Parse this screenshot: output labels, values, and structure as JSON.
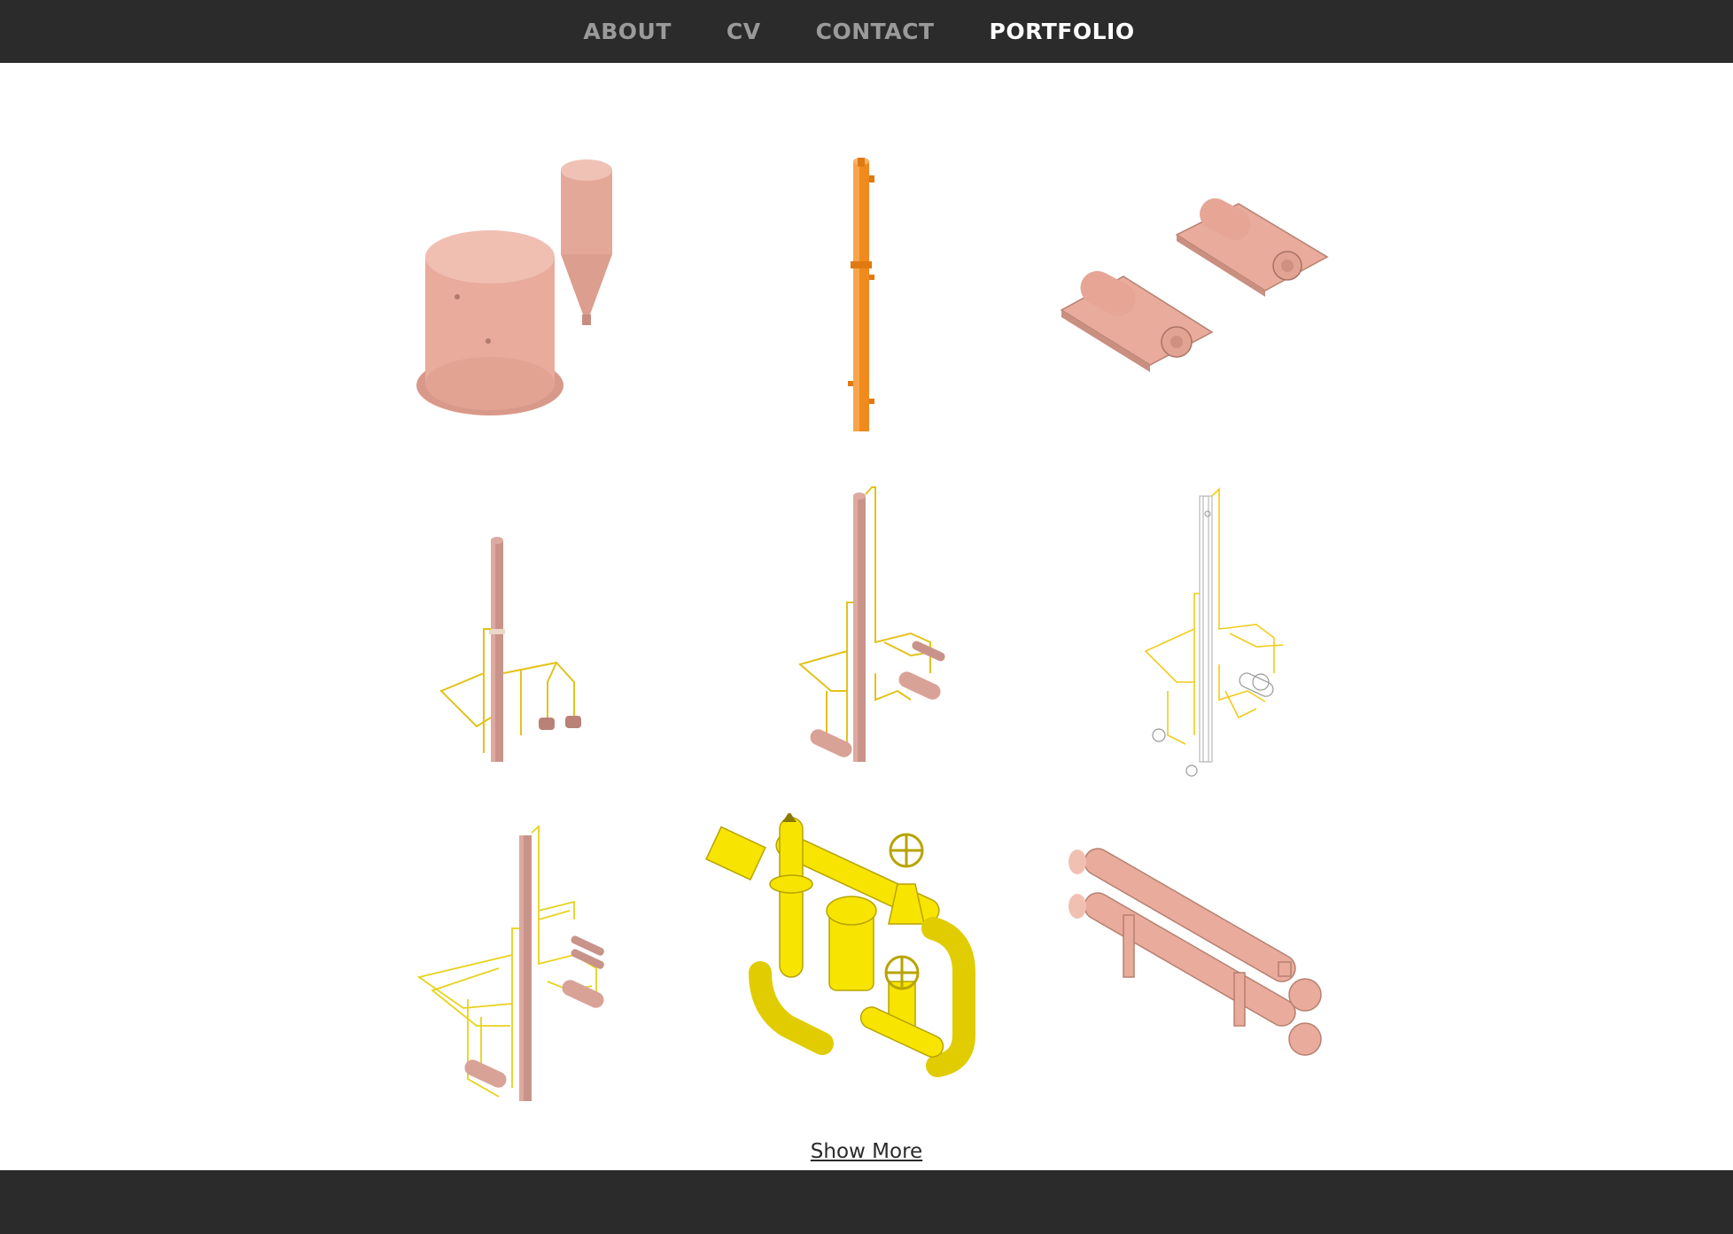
{
  "nav": {
    "items": [
      {
        "label": "ABOUT",
        "active": false
      },
      {
        "label": "CV",
        "active": false
      },
      {
        "label": "CONTACT",
        "active": false
      },
      {
        "label": "PORTFOLIO",
        "active": true
      }
    ]
  },
  "gallery": {
    "items": [
      {
        "name": "tank-and-silo",
        "color": "#e8ab9c"
      },
      {
        "name": "orange-column",
        "color": "#f08a1c"
      },
      {
        "name": "pump-skids",
        "color": "#e8ab9c"
      },
      {
        "name": "column-with-piping",
        "color": "#c9938a"
      },
      {
        "name": "column-piping-exchangers",
        "color": "#c9938a"
      },
      {
        "name": "wireframe-column-piping",
        "color": "#f5d21a"
      },
      {
        "name": "column-piping-detailed",
        "color": "#c9938a"
      },
      {
        "name": "yellow-valve-manifold",
        "color": "#f7e400"
      },
      {
        "name": "heat-exchangers",
        "color": "#e8ab9c"
      }
    ]
  },
  "show_more": {
    "label": "Show More"
  }
}
